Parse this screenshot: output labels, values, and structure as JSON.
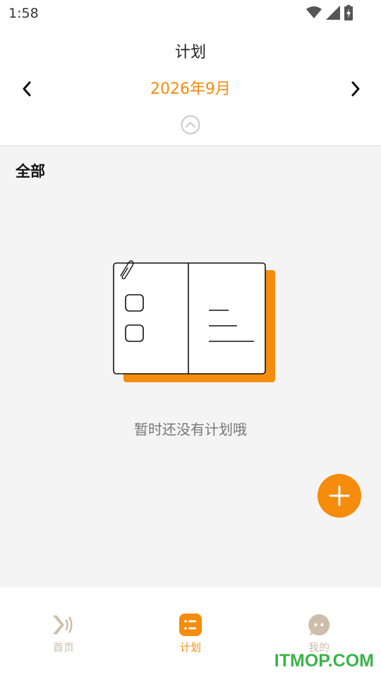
{
  "status_bar": {
    "time": "1:58",
    "icons": [
      "wifi-icon",
      "signal-icon",
      "battery-icon"
    ]
  },
  "header": {
    "title": "计划",
    "month": "2026年9月",
    "prev_icon": "chevron-left-icon",
    "next_icon": "chevron-right-icon",
    "collapse_icon": "chevron-up-circle-icon"
  },
  "filter": {
    "label": "全部"
  },
  "empty_state": {
    "icon": "notebook-illustration",
    "message": "暂时还没有计划哦"
  },
  "fab": {
    "icon": "plus-icon"
  },
  "bottom_nav": {
    "tabs": [
      {
        "label": "首页",
        "icon": "broadcast-icon",
        "active": false
      },
      {
        "label": "计划",
        "icon": "list-icon",
        "active": true
      },
      {
        "label": "我的",
        "icon": "chat-face-icon",
        "active": false
      }
    ]
  },
  "watermark": "ITMOP.COM",
  "colors": {
    "accent": "#F58C0C",
    "inactive_tab": "#CDBDA9",
    "watermark": "#3BB34A",
    "background": "#F4F4F4"
  }
}
